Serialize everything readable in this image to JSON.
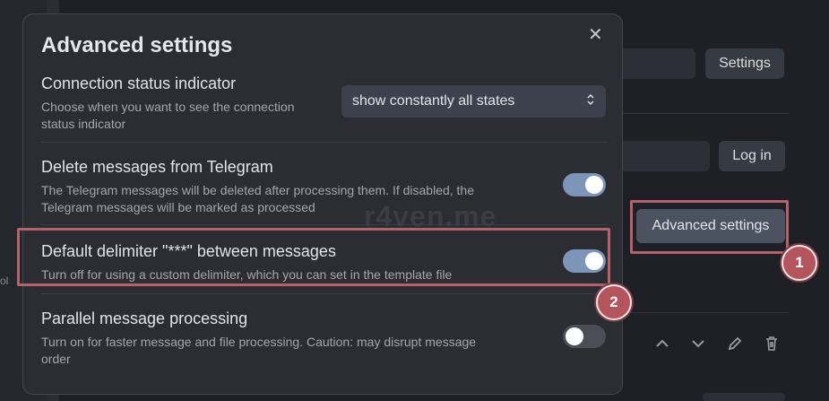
{
  "background": {
    "rail_text": "ol",
    "settings_button": "Settings",
    "login_button": "Log in",
    "advanced_button": "Advanced settings",
    "icons": [
      "chevron-up-icon",
      "chevron-down-icon",
      "pencil-icon",
      "trash-icon"
    ]
  },
  "modal": {
    "title": "Advanced settings",
    "close_glyph": "✕",
    "connection": {
      "title": "Connection status indicator",
      "desc_line1": "Choose when you want to see the connection",
      "desc_line2": "status indicator",
      "select_value": "show constantly all states"
    },
    "delete": {
      "title": "Delete messages from Telegram",
      "desc_line1": "The Telegram messages will be deleted after processing them. If disabled, the",
      "desc_line2": "Telegram messages will be marked as processed",
      "enabled": true
    },
    "delimiter": {
      "title": "Default delimiter \"***\" between messages",
      "desc": "Turn off for using a custom delimiter, which you can set in the template file",
      "enabled": true
    },
    "parallel": {
      "title": "Parallel message processing",
      "desc_line1": "Turn on for faster message and file processing. Caution: may disrupt message",
      "desc_line2": "order",
      "enabled": false
    }
  },
  "watermark": "r4ven.me",
  "callouts": [
    "1",
    "2"
  ],
  "colors": {
    "toggle_on": "#7d95b8",
    "highlight": "#b4636b",
    "callout": "#b4545c"
  }
}
